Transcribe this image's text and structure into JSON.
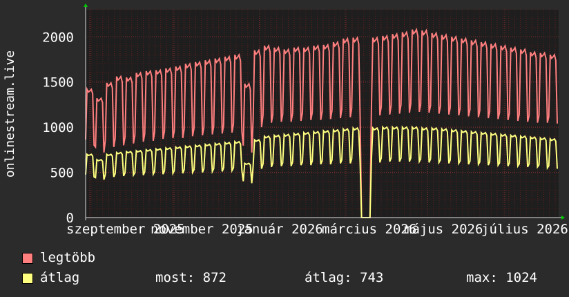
{
  "chart_data": {
    "type": "line",
    "ylabel": "onlinestream.live",
    "ylim": [
      0,
      2300
    ],
    "yticks": [
      0,
      500,
      1000,
      1500,
      2000
    ],
    "x_tick_labels": [
      "szeptember 2025",
      "november 2025",
      "január 2026",
      "március 2026",
      "május 2026",
      "július 2026"
    ],
    "grid": true,
    "series": [
      {
        "name": "legtöbb",
        "color": "#ff7f7f",
        "weekly_peak": [
          1420,
          1320,
          1490,
          1560,
          1550,
          1600,
          1620,
          1630,
          1650,
          1670,
          1700,
          1720,
          1740,
          1760,
          1780,
          1800,
          1480,
          1850,
          1900,
          1880,
          1860,
          1880,
          1880,
          1900,
          1910,
          1940,
          1980,
          1990,
          0,
          1990,
          2010,
          2030,
          2050,
          2080,
          2070,
          2040,
          2020,
          2000,
          1980,
          1960,
          1940,
          1920,
          1900,
          1880,
          1860,
          1830,
          1820,
          1800
        ],
        "weekly_trough": [
          800,
          720,
          780,
          800,
          820,
          840,
          850,
          870,
          880,
          880,
          900,
          910,
          920,
          930,
          940,
          950,
          720,
          1000,
          1050,
          1060,
          1060,
          1070,
          1080,
          1080,
          1090,
          1100,
          1110,
          1120,
          0,
          1130,
          1140,
          1150,
          1160,
          1170,
          1160,
          1150,
          1140,
          1130,
          1120,
          1110,
          1100,
          1090,
          1080,
          1070,
          1060,
          1050,
          1050,
          1040
        ]
      },
      {
        "name": "átlag",
        "color": "#ffff80",
        "weekly_peak": [
          700,
          640,
          700,
          720,
          730,
          740,
          750,
          760,
          770,
          780,
          790,
          800,
          810,
          820,
          830,
          840,
          600,
          860,
          900,
          910,
          920,
          930,
          940,
          950,
          960,
          970,
          980,
          990,
          0,
          990,
          1000,
          1000,
          1000,
          1000,
          990,
          990,
          980,
          970,
          960,
          950,
          940,
          930,
          920,
          910,
          900,
          890,
          880,
          870
        ],
        "weekly_trough": [
          450,
          420,
          450,
          460,
          470,
          470,
          480,
          480,
          490,
          490,
          500,
          500,
          510,
          510,
          520,
          520,
          380,
          540,
          560,
          570,
          570,
          580,
          580,
          590,
          590,
          600,
          600,
          610,
          0,
          610,
          620,
          620,
          620,
          620,
          610,
          610,
          600,
          600,
          590,
          590,
          580,
          580,
          570,
          570,
          560,
          560,
          550,
          540
        ]
      }
    ]
  },
  "legend": {
    "max_label": "legtöbb",
    "avg_label": "átlag",
    "now_text": "most: 872",
    "avg_text": "átlag: 743",
    "peak_text": "max: 1024"
  }
}
